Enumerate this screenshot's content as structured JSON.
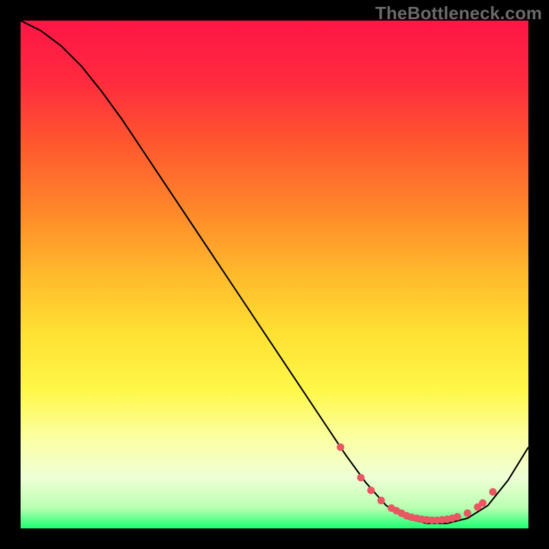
{
  "watermark": "TheBottleneck.com",
  "chart_data": {
    "type": "line",
    "title": "",
    "xlabel": "",
    "ylabel": "",
    "xlim": [
      0,
      100
    ],
    "ylim": [
      0,
      100
    ],
    "series": [
      {
        "name": "curve",
        "x": [
          0,
          4,
          8,
          12,
          16,
          20,
          24,
          28,
          32,
          36,
          40,
          44,
          48,
          52,
          56,
          60,
          64,
          68,
          72,
          76,
          80,
          84,
          88,
          92,
          96,
          100
        ],
        "values": [
          100,
          98,
          95,
          91,
          86,
          80.5,
          74.5,
          68.5,
          62.5,
          56.5,
          50.5,
          44.5,
          38.5,
          32.5,
          26.5,
          20.5,
          14.5,
          9.0,
          4.5,
          2.0,
          1.0,
          1.0,
          2.0,
          4.5,
          9.5,
          16.0
        ]
      }
    ],
    "markers": {
      "name": "dots",
      "x": [
        63,
        67,
        69,
        71,
        73,
        74,
        75,
        76,
        77,
        78,
        79,
        80,
        81,
        82,
        83,
        84,
        85,
        86,
        88,
        90,
        91,
        93
      ],
      "values": [
        16.0,
        10.0,
        7.5,
        5.5,
        4.0,
        3.5,
        3.0,
        2.5,
        2.2,
        2.0,
        1.8,
        1.7,
        1.6,
        1.6,
        1.7,
        1.8,
        2.0,
        2.3,
        3.0,
        4.2,
        5.0,
        7.2
      ]
    },
    "gradient_stops": [
      {
        "p": 0,
        "c": "#ff1547"
      },
      {
        "p": 12,
        "c": "#ff2b3e"
      },
      {
        "p": 25,
        "c": "#ff5a2e"
      },
      {
        "p": 38,
        "c": "#ff8a2a"
      },
      {
        "p": 50,
        "c": "#ffba2c"
      },
      {
        "p": 62,
        "c": "#ffe233"
      },
      {
        "p": 73,
        "c": "#fff84a"
      },
      {
        "p": 82,
        "c": "#fbffa1"
      },
      {
        "p": 90,
        "c": "#efffd6"
      },
      {
        "p": 96,
        "c": "#b9ffb1"
      },
      {
        "p": 100,
        "c": "#1bff71"
      }
    ],
    "marker_color": "#ea5661",
    "line_color": "#000000"
  }
}
